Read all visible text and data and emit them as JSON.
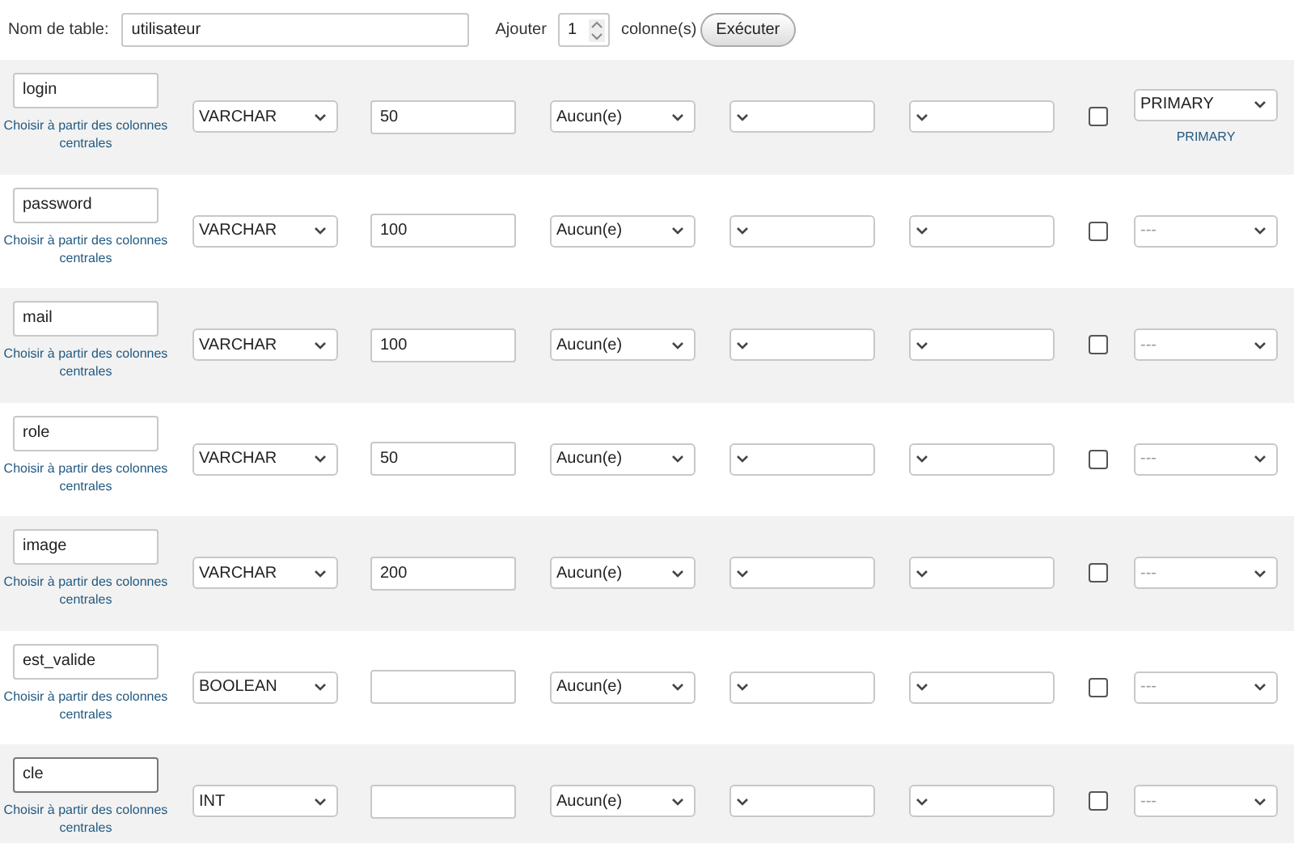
{
  "table_name": {
    "label": "Nom de table:",
    "value": "utilisateur"
  },
  "add_columns": {
    "label": "Ajouter",
    "value": "1",
    "suffix": "colonne(s)",
    "button": "Exécuter"
  },
  "rows": [
    {
      "name": "login",
      "focused": false,
      "central_link": "Choisir à partir des colonnes centrales",
      "type": "VARCHAR",
      "length": "50",
      "default": "Aucun(e)",
      "null_checked": false,
      "index": "PRIMARY",
      "index_link": "PRIMARY"
    },
    {
      "name": "password",
      "focused": false,
      "central_link": "Choisir à partir des colonnes centrales",
      "type": "VARCHAR",
      "length": "100",
      "default": "Aucun(e)",
      "null_checked": false,
      "index": "---"
    },
    {
      "name": "mail",
      "focused": false,
      "central_link": "Choisir à partir des colonnes centrales",
      "type": "VARCHAR",
      "length": "100",
      "default": "Aucun(e)",
      "null_checked": false,
      "index": "---"
    },
    {
      "name": "role",
      "focused": false,
      "central_link": "Choisir à partir des colonnes centrales",
      "type": "VARCHAR",
      "length": "50",
      "default": "Aucun(e)",
      "null_checked": false,
      "index": "---"
    },
    {
      "name": "image",
      "focused": false,
      "central_link": "Choisir à partir des colonnes centrales",
      "type": "VARCHAR",
      "length": "200",
      "default": "Aucun(e)",
      "null_checked": false,
      "index": "---"
    },
    {
      "name": "est_valide",
      "focused": false,
      "central_link": "Choisir à partir des colonnes centrales",
      "type": "BOOLEAN",
      "default": "Aucun(e)",
      "null_checked": false,
      "index": "---"
    },
    {
      "name": "cle",
      "focused": true,
      "central_link": "Choisir à partir des colonnes centrales",
      "type": "INT",
      "default": "Aucun(e)",
      "null_checked": false,
      "index": "---"
    }
  ]
}
